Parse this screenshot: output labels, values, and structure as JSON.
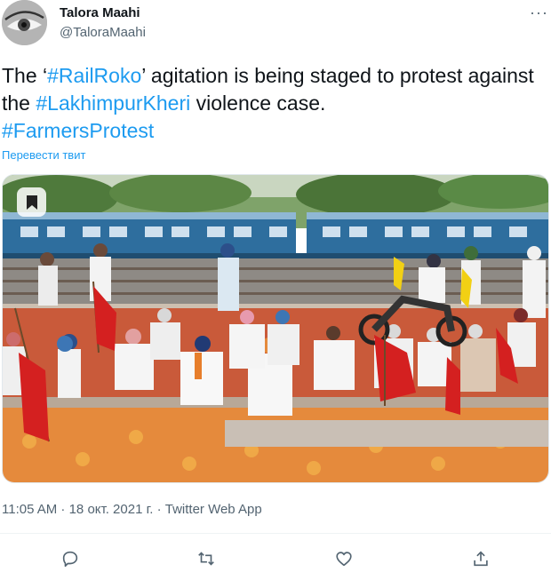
{
  "user": {
    "display_name": "Talora Maahi",
    "handle": "@TaloraMaahi"
  },
  "tweet": {
    "text_parts": [
      {
        "text": "The ‘",
        "hashtag": false
      },
      {
        "text": "#RailRoko",
        "hashtag": true
      },
      {
        "text": "’ agitation is being staged to protest against the ",
        "hashtag": false
      },
      {
        "text": "#LakhimpurKheri",
        "hashtag": true
      },
      {
        "text": " violence case.",
        "hashtag": false
      },
      {
        "text": "\n",
        "hashtag": false
      },
      {
        "text": "#FarmersProtest",
        "hashtag": true
      }
    ],
    "translate_label": "Перевести твит",
    "timestamp": "11:05 AM · 18 окт. 2021 г. · Twitter Web App"
  },
  "icons": {
    "more": "more-horizontal-icon",
    "reply": "reply-icon",
    "retweet": "retweet-icon",
    "like": "heart-icon",
    "share": "share-icon",
    "bookmark": "bookmark-icon"
  },
  "colors": {
    "accent": "#1d9bf0",
    "text": "#0f1419",
    "secondary": "#536471",
    "flag_red": "#d42020",
    "train_blue": "#2e6e9e",
    "mat_orange": "#e58a3c"
  }
}
